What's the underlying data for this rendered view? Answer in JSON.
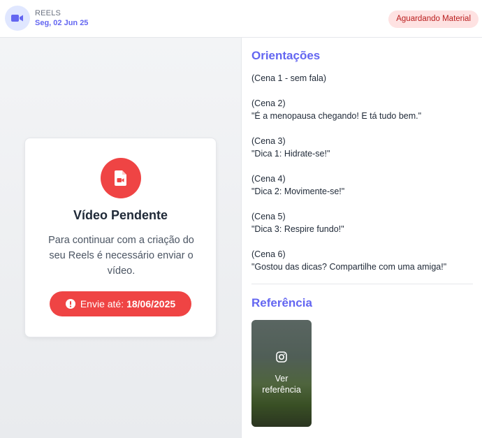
{
  "header": {
    "type_label": "REELS",
    "date": "Seg, 02 Jun 25",
    "status": "Aguardando Material",
    "icon": "video-camera-icon"
  },
  "pending": {
    "icon": "file-video-icon",
    "title": "Vídeo Pendente",
    "description": "Para continuar com a criação do seu Reels é necessário enviar o vídeo.",
    "deadline_label": "Envie até:",
    "deadline_date": "18/06/2025",
    "deadline_icon": "alert-circle-icon"
  },
  "guidelines": {
    "title": "Orientações",
    "scenes": [
      {
        "heading": "(Cena 1 - sem fala)",
        "line": ""
      },
      {
        "heading": "(Cena 2)",
        "line": "\"É a menopausa chegando! E tá tudo bem.\""
      },
      {
        "heading": "(Cena 3)",
        "line": "\"Dica 1: Hidrate-se!\""
      },
      {
        "heading": "(Cena 4)",
        "line": "\"Dica 2: Movimente-se!\""
      },
      {
        "heading": "(Cena 5)",
        "line": "\"Dica 3: Respire fundo!\""
      },
      {
        "heading": "(Cena 6)",
        "line": "\"Gostou das dicas? Compartilhe com uma amiga!\""
      }
    ]
  },
  "reference": {
    "title": "Referência",
    "link_label": "Ver referência",
    "icon": "instagram-icon"
  },
  "colors": {
    "accent": "#6366f1",
    "danger": "#ef4444",
    "badge_bg": "#fee2e2",
    "badge_text": "#b91c1c"
  }
}
